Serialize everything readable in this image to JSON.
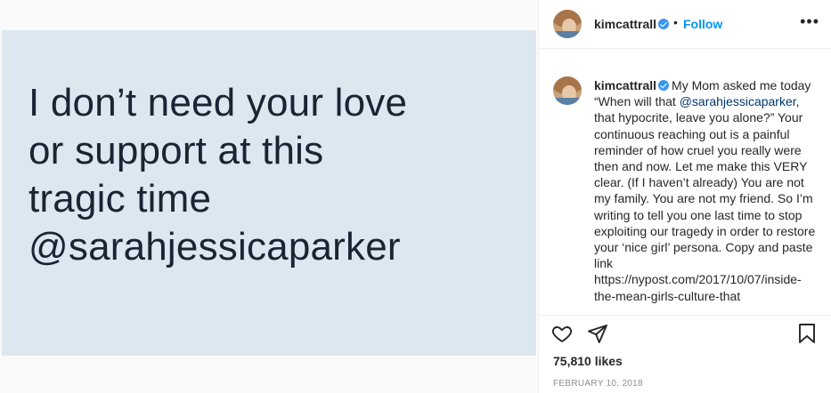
{
  "post_image": {
    "lines": [
      "I don’t need your love",
      "or support at this",
      "tragic time",
      "@sarahjessicaparker"
    ]
  },
  "header": {
    "username": "kimcattrall",
    "separator": "•",
    "follow_label": "Follow",
    "more_label": "•••"
  },
  "caption": {
    "username": "kimcattrall",
    "text_before": "My Mom asked me today “When will that ",
    "mention": "@sarahjessicaparker",
    "text_after": ", that hypocrite, leave you alone?” Your continuous reaching out is a painful reminder of how cruel you really were then and now. Let me make this VERY clear. (If I haven’t already) You are not my family. You are not my friend. So I’m writing to tell you one last time to stop exploiting our tragedy in order to restore your ‘nice girl’ persona. Copy and paste link https://nypost.com/2017/10/07/inside-the-mean-girls-culture-that"
  },
  "actions": {
    "likes": "75,810 likes",
    "date": "FEBRUARY 10, 2018",
    "icons": [
      "heart-icon",
      "share-icon",
      "bookmark-icon"
    ]
  },
  "colors": {
    "image_background": "#dde7ef",
    "image_text": "#1b2433",
    "accent": "#0095f6",
    "verified": "#3897f0",
    "mention": "#00376b",
    "muted": "#8e8e8e"
  }
}
